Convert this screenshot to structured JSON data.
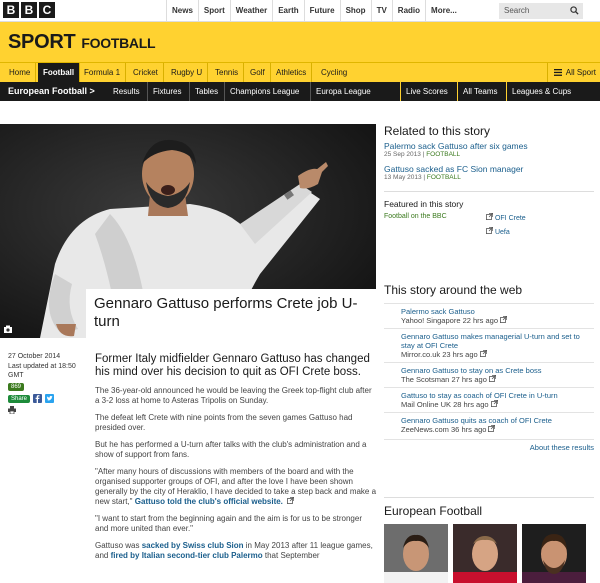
{
  "brand": {
    "letters": [
      "B",
      "B",
      "C"
    ]
  },
  "topnav": {
    "items": [
      "News",
      "Sport",
      "Weather",
      "Earth",
      "Future",
      "Shop",
      "TV",
      "Radio",
      "More..."
    ],
    "search_placeholder": "Search"
  },
  "sport_header": {
    "title": "SPORT",
    "subtitle": "FOOTBALL"
  },
  "sport_nav": {
    "items": [
      "Home",
      "Football",
      "Formula 1",
      "Cricket",
      "Rugby U",
      "Tennis",
      "Golf",
      "Athletics",
      "Cycling"
    ],
    "active": "Football",
    "all_sport": "All Sport"
  },
  "section_nav": {
    "title": "European Football >",
    "items": [
      "Results",
      "Fixtures",
      "Tables",
      "Champions League",
      "Europa League"
    ],
    "right_items": [
      "Live Scores",
      "All Teams",
      "Leagues & Cups"
    ]
  },
  "article": {
    "headline": "Gennaro Gattuso performs Crete job U-turn",
    "date": "27 October 2014",
    "updated": "Last updated at 18:50 GMT",
    "count": "869",
    "share_label": "Share",
    "intro": "Former Italy midfielder Gennaro Gattuso has changed his mind over his decision to quit as OFI Crete boss.",
    "paragraphs": [
      {
        "text": "The 36-year-old announced he would be leaving the Greek top-flight club after a 3-2 loss at home to Asteras Tripolis on Sunday."
      },
      {
        "text": "The defeat left Crete with nine points from the seven games Gattuso had presided over."
      },
      {
        "text": "But he has performed a U-turn after talks with the club's administration and a show of support from fans."
      },
      {
        "text": "\"After many hours of discussions with members of the board and with the organised supporter groups of OFI, and after the love I have been shown generally by the city of Heraklio, I have decided to take a step back and make a new start,\"",
        "link": "Gattuso told the club's official website."
      },
      {
        "text": "\"I want to start from the beginning again and the aim is for us to be stronger and more united than ever.\""
      },
      {
        "pre": "Gattuso was",
        "link": "sacked by Swiss club Sion",
        "mid": "in May 2013 after 11 league games, and",
        "link2": "fired by Italian second-tier club Palermo",
        "post": "that September"
      }
    ]
  },
  "related": {
    "title": "Related to this story",
    "items": [
      {
        "link": "Palermo sack Gattuso after six games",
        "date": "25 Sep 2013",
        "tag": "FOOTBALL"
      },
      {
        "link": "Gattuso sacked as FC Sion manager",
        "date": "13 May 2013",
        "tag": "FOOTBALL"
      }
    ],
    "featured_title": "Featured in this story",
    "featured": {
      "left": "Football on the BBC",
      "right": [
        "OFI Crete",
        "Uefa"
      ]
    }
  },
  "web": {
    "title": "This story around the web",
    "items": [
      {
        "link": "Palermo sack Gattuso",
        "source": "Yahoo! Singapore 22 hrs ago"
      },
      {
        "link": "Gennaro Gattuso makes managerial U-turn and set to stay at OFI Crete",
        "source": "Mirror.co.uk 23 hrs ago"
      },
      {
        "link": "Gennaro Gattuso to stay on as Crete boss",
        "source": "The Scotsman 27 hrs ago"
      },
      {
        "link": "Gattuso to stay as coach of OFI Crete in U-turn",
        "source": "Mail Online UK 28 hrs ago"
      },
      {
        "link": "Gennaro Gattuso quits as coach of OFI Crete",
        "source": "ZeeNews.com 36 hrs ago"
      }
    ],
    "about": "About these results"
  },
  "euro": {
    "title": "European Football"
  },
  "colors": {
    "sport_yellow": "#ffd230",
    "black": "#1a1a1a",
    "link_blue": "#1a5e8c",
    "tag_green": "#3b7a1e"
  }
}
